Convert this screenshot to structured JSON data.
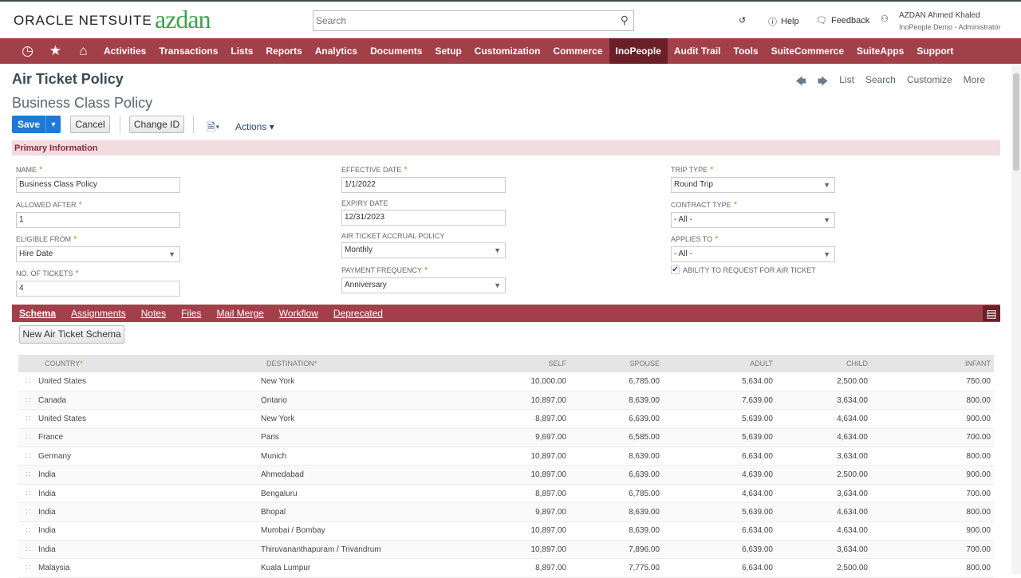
{
  "header": {
    "brand": "ORACLE NETSUITE",
    "client_logo": "azdan",
    "search_placeholder": "Search",
    "help": "Help",
    "feedback": "Feedback",
    "user_name": "AZDAN Ahmed Khaled",
    "user_role": "InoPeople Demo - Administrator"
  },
  "nav": {
    "items": [
      "Activities",
      "Transactions",
      "Lists",
      "Reports",
      "Analytics",
      "Documents",
      "Setup",
      "Customization",
      "Commerce",
      "InoPeople",
      "Audit Trail",
      "Tools",
      "SuiteCommerce",
      "SuiteApps",
      "Support"
    ],
    "active": "InoPeople"
  },
  "page": {
    "title": "Air Ticket Policy",
    "record": "Business Class Policy",
    "links": {
      "list": "List",
      "search": "Search",
      "customize": "Customize",
      "more": "More"
    }
  },
  "toolbar": {
    "save": "Save",
    "cancel": "Cancel",
    "change_id": "Change ID",
    "actions": "Actions"
  },
  "section": {
    "title": "Primary Information"
  },
  "fields": {
    "name": {
      "label": "NAME",
      "value": "Business Class Policy"
    },
    "allowed_after": {
      "label": "ALLOWED AFTER",
      "value": "1"
    },
    "eligible_from": {
      "label": "ELIGIBLE FROM",
      "value": "Hire Date"
    },
    "no_of_tickets": {
      "label": "NO. OF TICKETS",
      "value": "4"
    },
    "effective_date": {
      "label": "EFFECTIVE DATE",
      "value": "1/1/2022"
    },
    "expiry_date": {
      "label": "EXPIRY DATE",
      "value": "12/31/2023"
    },
    "accrual_policy": {
      "label": "AIR TICKET ACCRUAL POLICY",
      "value": "Monthly"
    },
    "payment_frequency": {
      "label": "PAYMENT FREQUENCY",
      "value": "Anniversary"
    },
    "trip_type": {
      "label": "TRIP TYPE",
      "value": "Round Trip"
    },
    "contract_type": {
      "label": "CONTRACT TYPE",
      "value": "- All -"
    },
    "applies_to": {
      "label": "APPLIES TO",
      "value": "- All -"
    },
    "ability_request": {
      "label": "ABILITY TO REQUEST FOR AIR TICKET",
      "checked": true
    }
  },
  "tabs": [
    "Schema",
    "Assignments",
    "Notes",
    "Files",
    "Mail Merge",
    "Workflow",
    "Deprecated"
  ],
  "active_tab": "Schema",
  "schema": {
    "new_button": "New Air Ticket Schema",
    "columns": [
      "COUNTRY",
      "DESTINATION",
      "SELF",
      "SPOUSE",
      "ADULT",
      "CHILD",
      "INFANT"
    ],
    "rows": [
      [
        "United States",
        "New York",
        "10,000.00",
        "6,785.00",
        "5,634.00",
        "2,500.00",
        "750.00"
      ],
      [
        "Canada",
        "Ontario",
        "10,897.00",
        "8,639.00",
        "7,639.00",
        "3,634.00",
        "800.00"
      ],
      [
        "United States",
        "New York",
        "8,897.00",
        "6,639.00",
        "5,639.00",
        "4,634.00",
        "900.00"
      ],
      [
        "France",
        "Paris",
        "9,697.00",
        "6,585.00",
        "5,639.00",
        "4,634.00",
        "700.00"
      ],
      [
        "Germany",
        "Munich",
        "10,897.00",
        "8,639.00",
        "6,634.00",
        "3,634.00",
        "800.00"
      ],
      [
        "India",
        "Ahmedabad",
        "10,897.00",
        "6,639.00",
        "4,639.00",
        "2,500.00",
        "900.00"
      ],
      [
        "India",
        "Bengaluru",
        "8,897.00",
        "6,785.00",
        "4,634.00",
        "3,634.00",
        "700.00"
      ],
      [
        "India",
        "Bhopal",
        "9,897.00",
        "8,639.00",
        "5,639.00",
        "4,634.00",
        "800.00"
      ],
      [
        "India",
        "Mumbai / Bombay",
        "10,897.00",
        "8,639.00",
        "6,634.00",
        "4,634.00",
        "900.00"
      ],
      [
        "India",
        "Thiruvananthapuram / Trivandrum",
        "10,897.00",
        "7,896.00",
        "6,639.00",
        "3,634.00",
        "700.00"
      ],
      [
        "Malaysia",
        "Kuala Lumpur",
        "8,897.00",
        "7,775.00",
        "6,634.00",
        "2,500.00",
        "800.00"
      ]
    ]
  },
  "colors": {
    "nav": "#a2404a",
    "nav_active": "#6a2026",
    "save": "#1e7ad6",
    "section_bg": "#f1dcdf"
  }
}
